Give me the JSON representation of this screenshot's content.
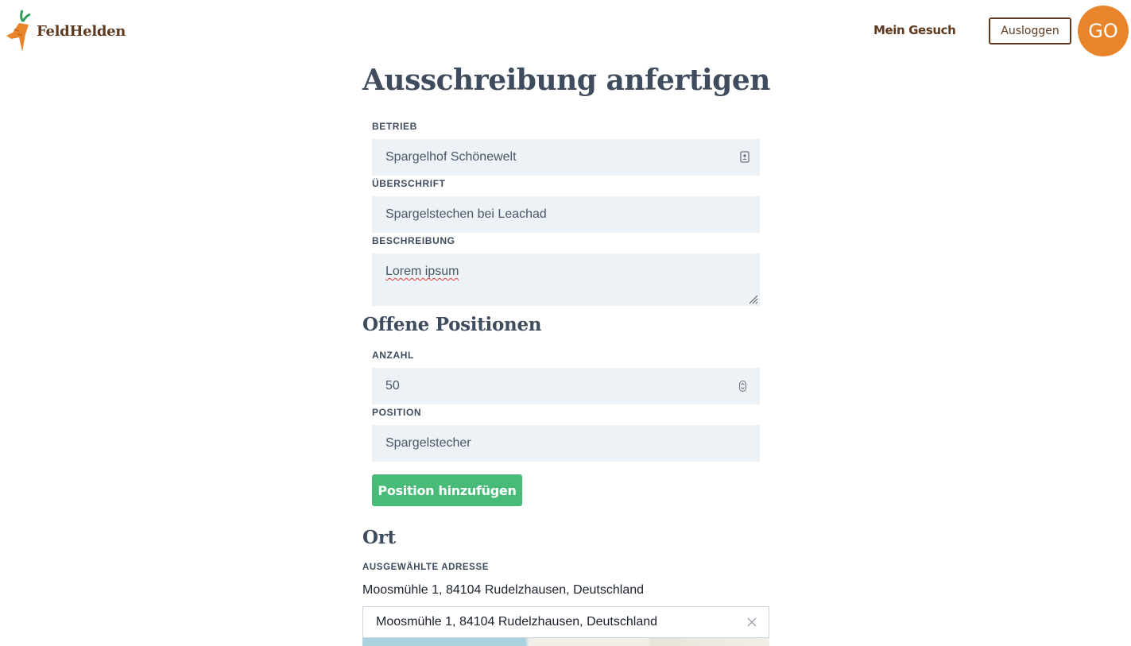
{
  "header": {
    "logo_text": "FeldHelden",
    "nav_link": "Mein Gesuch",
    "logout_label": "Ausloggen",
    "avatar_initials": "GO"
  },
  "page_title": "Ausschreibung anfertigen",
  "form": {
    "betrieb_label": "BETRIEB",
    "betrieb_value": "Spargelhof Schönewelt",
    "ueberschrift_label": "ÜBERSCHRIFT",
    "ueberschrift_value": "Spargelstechen bei Leachad",
    "beschreibung_label": "BESCHREIBUNG",
    "beschreibung_value": "Lorem ipsum"
  },
  "positions": {
    "heading": "Offene Positionen",
    "anzahl_label": "ANZAHL",
    "anzahl_value": "50",
    "position_label": "POSITION",
    "position_value": "Spargelstecher",
    "add_button_label": "Position hinzufügen"
  },
  "location": {
    "heading": "Ort",
    "selected_label": "AUSGEWÄHLTE ADRESSE",
    "selected_address": "Moosmühle 1, 84104 Rudelzhausen, Deutschland",
    "search_value": "Moosmühle 1, 84104 Rudelzhausen, Deutschland"
  },
  "icons": {
    "logo": "carrot-logo-icon",
    "betrieb_field": "contact-card-icon",
    "anzahl_field": "spinner-arrows-icon",
    "search_clear": "close-icon"
  },
  "colors": {
    "brand_brown": "#5d3a1f",
    "avatar_orange": "#e8852a",
    "button_green": "#48bb78",
    "field_bg": "#edf2f7"
  }
}
